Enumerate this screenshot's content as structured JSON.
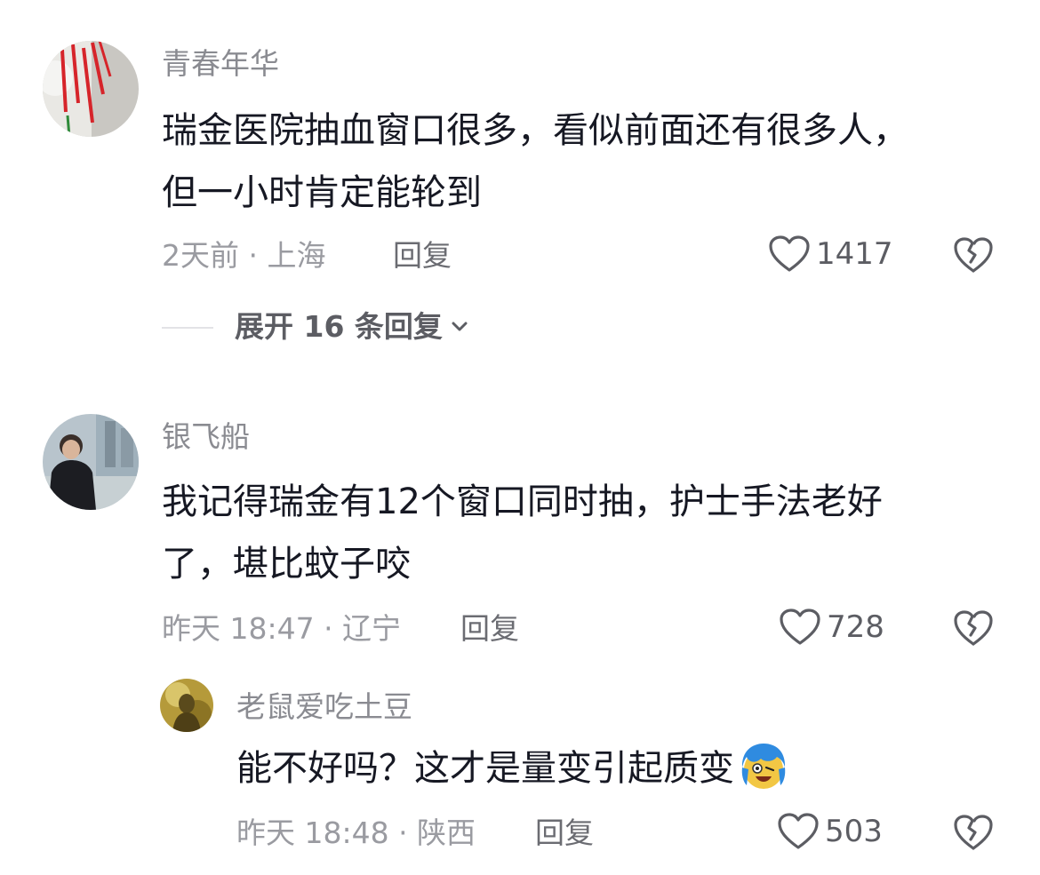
{
  "comments": [
    {
      "username": "青春年华",
      "avatar_icon": "avatar-red-ribbons",
      "content_line1": "瑞金医院抽血窗口很多，看似前面还有很多人，",
      "content_line2": "但一小时肯定能轮到",
      "meta": "2天前 · 上海",
      "reply_label": "回复",
      "likes": "1417",
      "expand_label": "展开 16 条回复"
    },
    {
      "username": "银飞船",
      "avatar_icon": "avatar-man-city",
      "content_line1": "我记得瑞金有12个窗口同时抽，护士手法老好",
      "content_line2": "了，堪比蚊子咬",
      "meta": "昨天 18:47 · 辽宁",
      "reply_label": "回复",
      "likes": "728"
    },
    {
      "username": "老鼠爱吃土豆",
      "avatar_icon": "avatar-golden-portrait",
      "content": "能不好吗？这才是量变引起质变",
      "emoji_icon": "blue-hair-laughing-emoji",
      "meta": "昨天 18:48 · 陕西",
      "reply_label": "回复",
      "likes": "503"
    }
  ],
  "icons": {
    "like": "heart-outline-icon",
    "dislike": "broken-heart-icon",
    "expand": "chevron-down-icon"
  },
  "colors": {
    "text": "#161823",
    "username": "#8a8b91",
    "meta": "#9a9ba1",
    "icon": "#5c5d63"
  }
}
